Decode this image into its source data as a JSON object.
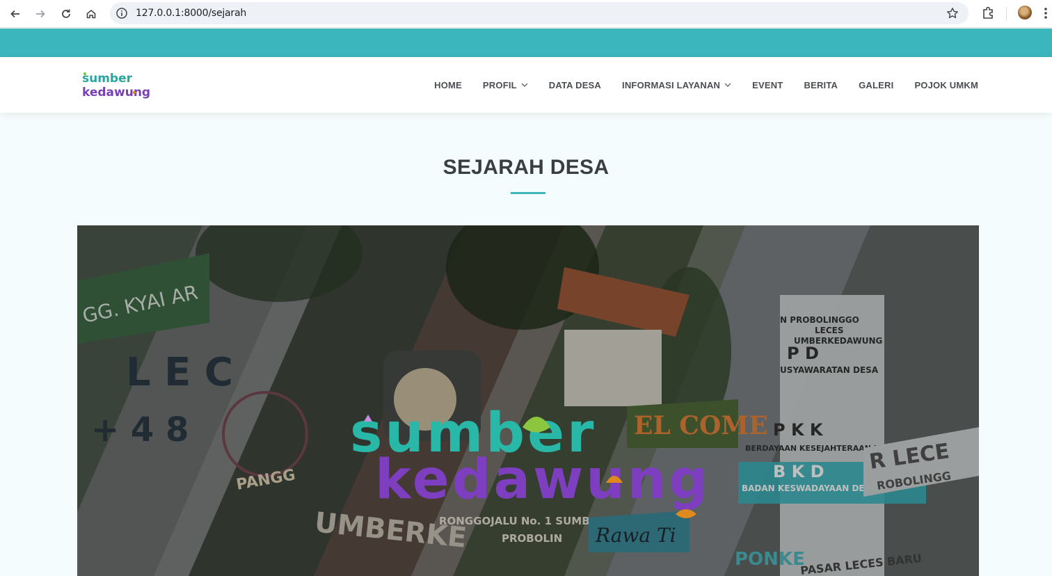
{
  "browser": {
    "url": "127.0.0.1:8000/sejarah"
  },
  "header": {
    "brand_line1": "sumber",
    "brand_line2": "kedawung",
    "nav": [
      {
        "label": "HOME",
        "has_dropdown": false
      },
      {
        "label": "PROFIL",
        "has_dropdown": true
      },
      {
        "label": "DATA DESA",
        "has_dropdown": false
      },
      {
        "label": "INFORMASI LAYANAN",
        "has_dropdown": true
      },
      {
        "label": "EVENT",
        "has_dropdown": false
      },
      {
        "label": "BERITA",
        "has_dropdown": false
      },
      {
        "label": "GALERI",
        "has_dropdown": false
      },
      {
        "label": "POJOK UMKM",
        "has_dropdown": false
      }
    ]
  },
  "page": {
    "title": "SEJARAH DESA"
  },
  "hero": {
    "logo_line1": "sumber",
    "logo_line2": "kedawung",
    "signs": {
      "street": "GG. KYAI AR",
      "leces": "L E C",
      "number": "+ 4 8",
      "welcome": "EL COME",
      "pangg": "PANGG",
      "sumberke": "UMBERKE",
      "address": "RONGGOJALU No. 1 SUMB",
      "probolin": "PROBOLIN",
      "rawa": "Rawa Ti",
      "kab": "N PROBOLINGGO",
      "leces2": "LECES",
      "sumberkedawung": "UMBERKEDAWUNG",
      "bpd": "P D",
      "musy": "USYAWARATAN DESA",
      "pkk": "P K K",
      "pkk_full": "BERDAYAAN KESEJAHTERAAN KELUARGA",
      "bkd": "B K D",
      "bkd_full": "BADAN KESWADAYAAN DE",
      "ponke": "PONKE",
      "pasar": "PASAR LECES BARU",
      "lec": "R LECE",
      "probolingg": "ROBOLINGG"
    }
  },
  "colors": {
    "accent": "#3bb6bd",
    "title": "#3a3d42",
    "nav_text": "#4a4d52"
  }
}
